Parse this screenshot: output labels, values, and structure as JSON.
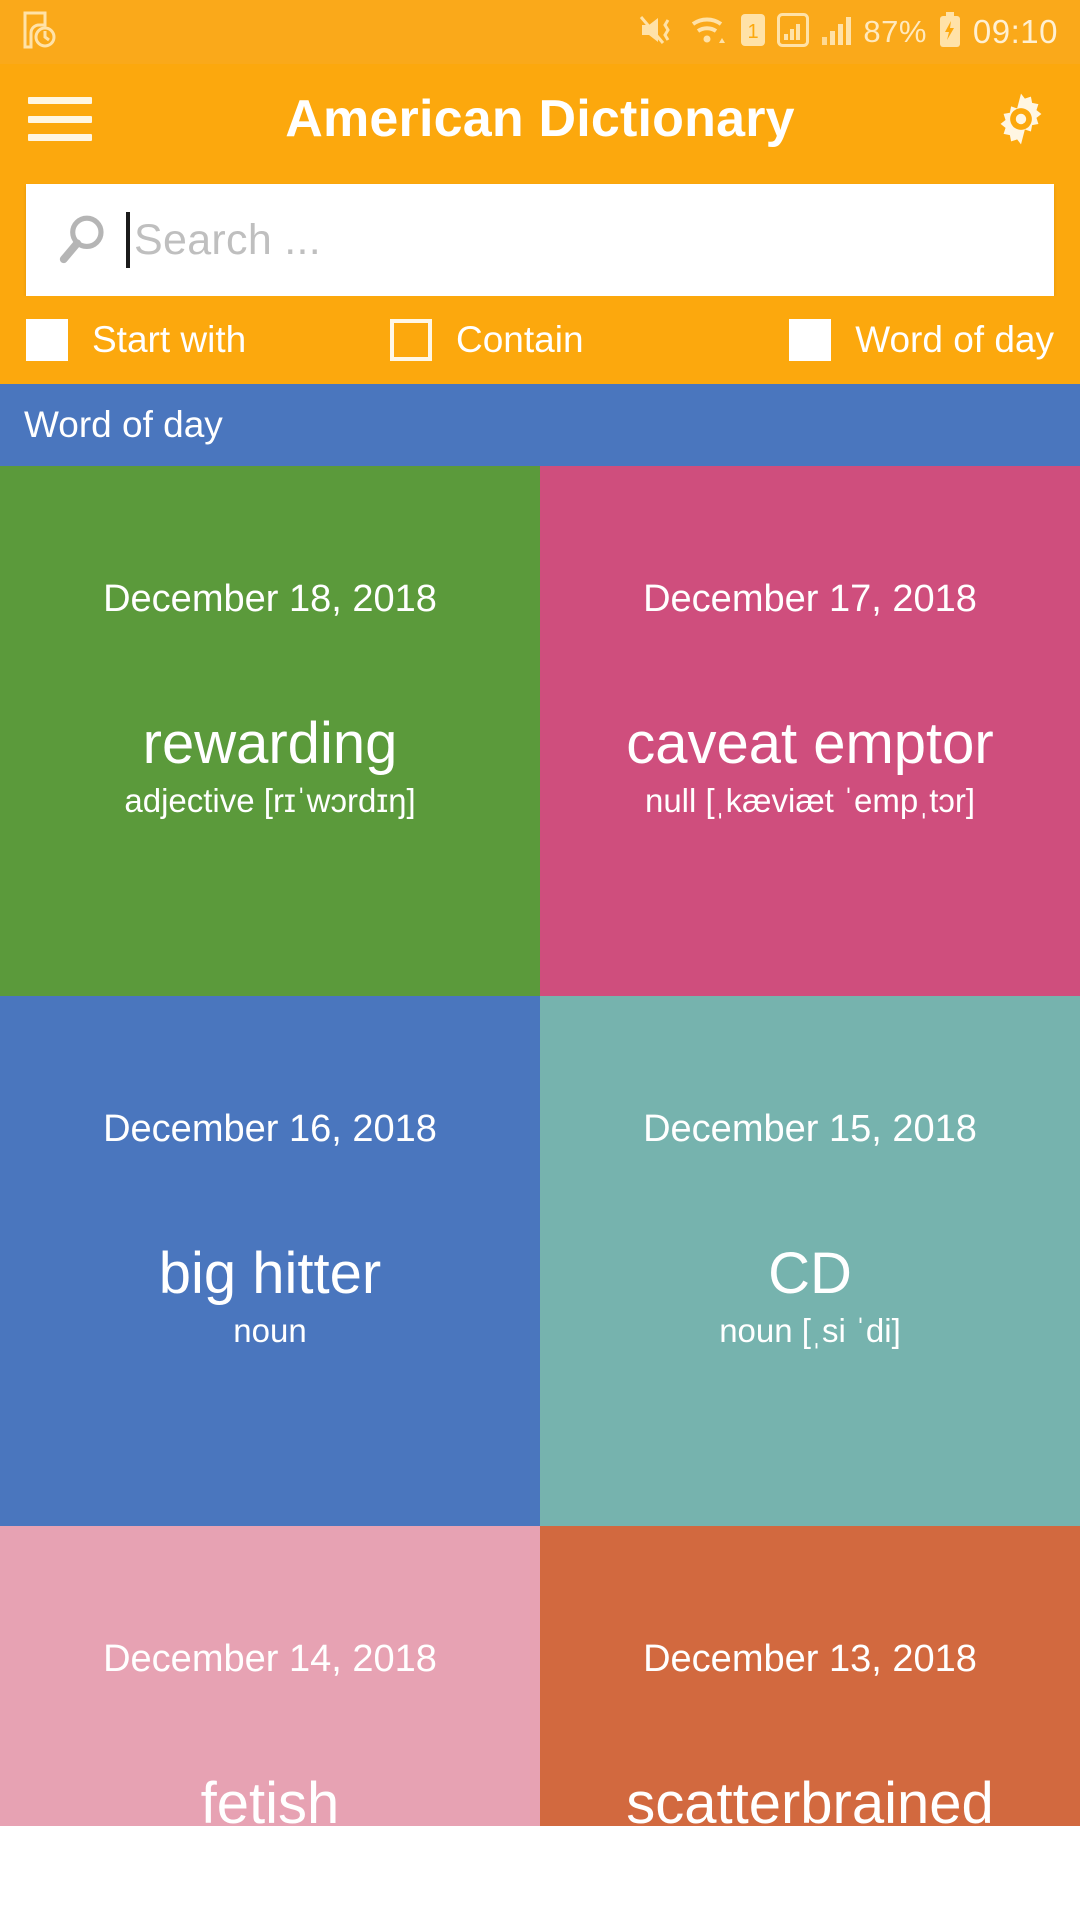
{
  "statusbar": {
    "left_icons": [
      "screenshot-clock-icon"
    ],
    "right_icons": [
      "mute-vibrate-icon",
      "wifi-icon",
      "sim-1-icon",
      "signal-box-icon",
      "signal-bars-icon"
    ],
    "battery_percent": "87%",
    "battery_state": "charging",
    "time": "09:10",
    "bar_color": "#FAA91A"
  },
  "appbar": {
    "menu_icon": "hamburger-menu-icon",
    "title": "American Dictionary",
    "settings_icon": "gear-icon",
    "bar_color": "#FCA80D"
  },
  "search": {
    "icon": "magnifier-icon",
    "value": "",
    "placeholder": "Search ...",
    "cursor_visible": true
  },
  "filters": [
    {
      "label": "Start with",
      "checked": true
    },
    {
      "label": "Contain",
      "checked": false
    },
    {
      "label": "Word of day",
      "checked": true
    }
  ],
  "section": {
    "title": "Word of day",
    "color": "#4A76BE"
  },
  "tiles": [
    {
      "date": "December 18, 2018",
      "word": "rewarding",
      "meta": "adjective [rɪˈwɔrdɪŋ]",
      "color": "#5B9A3B"
    },
    {
      "date": "December 17, 2018",
      "word": "caveat emptor",
      "meta": "null [ˌkæviæt ˈempˌtɔr]",
      "color": "#CF4E7D"
    },
    {
      "date": "December 16, 2018",
      "word": "big hitter",
      "meta": "noun",
      "color": "#4A76BE"
    },
    {
      "date": "December 15, 2018",
      "word": "CD",
      "meta": "noun [ˌsi ˈdi]",
      "color": "#76B3AE"
    },
    {
      "date": "December 14, 2018",
      "word": "fetish",
      "meta": "",
      "color": "#E7A2B3"
    },
    {
      "date": "December 13, 2018",
      "word": "scatterbrained",
      "meta": "",
      "color": "#D2693F"
    }
  ]
}
